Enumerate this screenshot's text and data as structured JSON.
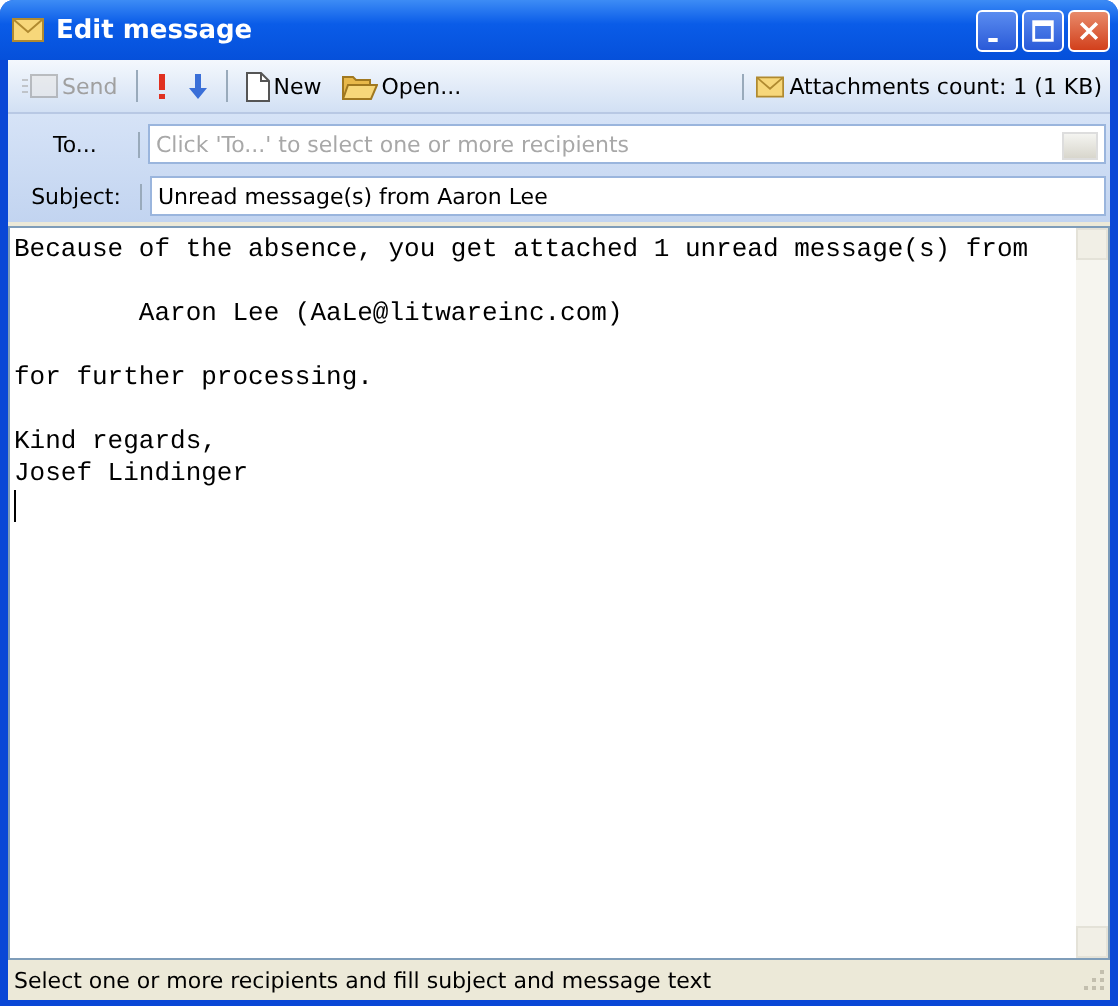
{
  "window": {
    "title": "Edit message"
  },
  "toolbar": {
    "buttons": [
      {
        "kind": "send",
        "label": "Send",
        "disabled": true
      },
      {
        "kind": "separator"
      },
      {
        "kind": "high-priority",
        "disabled": false
      },
      {
        "kind": "low-priority",
        "disabled": false
      },
      {
        "kind": "separator"
      },
      {
        "kind": "new",
        "label": "New",
        "disabled": false
      },
      {
        "kind": "open",
        "label": "Open...",
        "disabled": false
      }
    ],
    "attachments": "Attachments count: 1  (1 KB)"
  },
  "to": {
    "label": "To...",
    "placeholder": "Click 'To...' to select one or more recipients"
  },
  "subject": {
    "label": "Subject:",
    "value": "Unread message(s) from Aaron Lee"
  },
  "body": {
    "paragraphs": [
      [
        "Because of the absence, you get attached 1 unread message(s) from"
      ],
      [
        "        Aaron Lee (AaLe@litwareinc.com)"
      ],
      [
        "for further processing."
      ],
      [
        "Kind regards,",
        "Josef Lindinger"
      ]
    ]
  },
  "status_bar": "Select one or more recipients and fill subject and message text"
}
